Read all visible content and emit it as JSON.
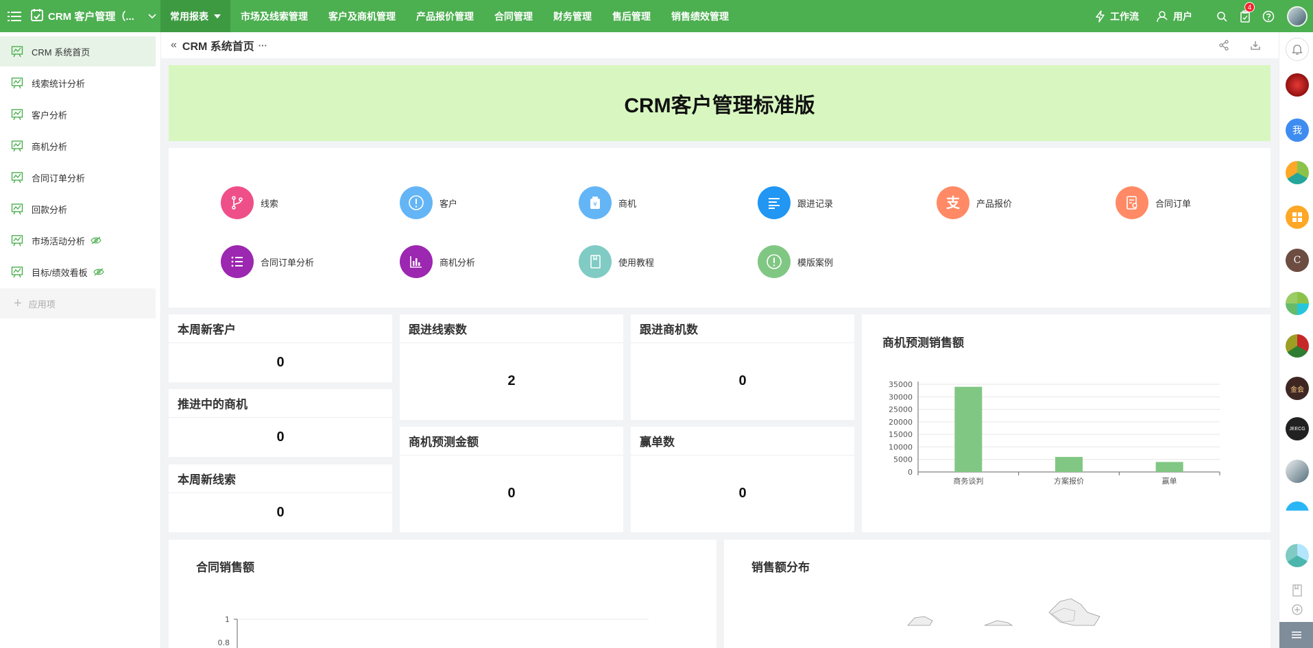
{
  "app": {
    "title": "CRM 客户管理（..."
  },
  "nav": [
    {
      "label": "常用报表"
    },
    {
      "label": "市场及线索管理"
    },
    {
      "label": "客户及商机管理"
    },
    {
      "label": "产品报价管理"
    },
    {
      "label": "合同管理"
    },
    {
      "label": "财务管理"
    },
    {
      "label": "售后管理"
    },
    {
      "label": "销售绩效管理"
    }
  ],
  "topbar": {
    "workflow": "工作流",
    "user": "用户",
    "badge_count": "4"
  },
  "sidebar": {
    "items": [
      {
        "label": "CRM 系统首页"
      },
      {
        "label": "线索统计分析"
      },
      {
        "label": "客户分析"
      },
      {
        "label": "商机分析"
      },
      {
        "label": "合同订单分析"
      },
      {
        "label": "回款分析"
      },
      {
        "label": "市场活动分析"
      },
      {
        "label": "目标/绩效看板"
      }
    ],
    "add_label": "应用项"
  },
  "breadcrumb": {
    "title": "CRM 系统首页",
    "more": "···"
  },
  "banner": {
    "title": "CRM客户管理标准版"
  },
  "quick_links": [
    {
      "label": "线索",
      "color": "#ef4f88"
    },
    {
      "label": "客户",
      "color": "#64b5f6"
    },
    {
      "label": "商机",
      "color": "#64b5f6"
    },
    {
      "label": "跟进记录",
      "color": "#2196f3"
    },
    {
      "label": "产品报价",
      "color": "#ff8a65"
    },
    {
      "label": "合同订单",
      "color": "#ff8a65"
    },
    {
      "label": "合同订单分析",
      "color": "#9c27b0"
    },
    {
      "label": "商机分析",
      "color": "#9c27b0"
    },
    {
      "label": "使用教程",
      "color": "#80cbc4"
    },
    {
      "label": "模版案例",
      "color": "#81c784"
    }
  ],
  "stats": [
    {
      "title": "本周新客户",
      "value": "0"
    },
    {
      "title": "推进中的商机",
      "value": "0"
    },
    {
      "title": "本周新线索",
      "value": "0"
    },
    {
      "title": "跟进线索数",
      "value": "2"
    },
    {
      "title": "商机预测金额",
      "value": "0"
    },
    {
      "title": "跟进商机数",
      "value": "0"
    },
    {
      "title": "赢单数",
      "value": "0"
    }
  ],
  "chart_data": [
    {
      "type": "bar",
      "title": "商机预测销售额",
      "categories": [
        "商务谈判",
        "方案报价",
        "赢单"
      ],
      "values": [
        34000,
        6000,
        4000
      ],
      "yticks": [
        "0",
        "5000",
        "10000",
        "15000",
        "20000",
        "25000",
        "30000",
        "35000"
      ],
      "ylim": [
        0,
        35000
      ],
      "color": "#81c784",
      "grid": true
    },
    {
      "type": "line",
      "title": "合同销售额",
      "yticks_visible": [
        "1",
        "0.8"
      ]
    },
    {
      "type": "map",
      "title": "销售额分布"
    }
  ],
  "rail": {
    "me_label": "我",
    "c_label": "C",
    "gold_label": "金会",
    "jeecg_label": "JEECG"
  }
}
